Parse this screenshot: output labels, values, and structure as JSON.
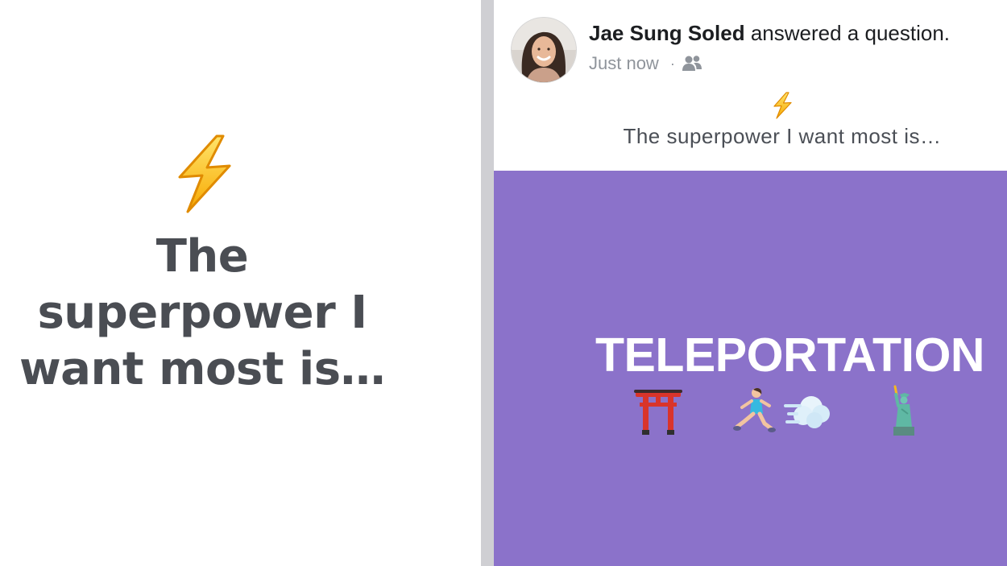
{
  "left_card": {
    "icon": "lightning-bolt-icon",
    "prompt_text": "The superpower I want most is…"
  },
  "post": {
    "author": {
      "name": "Jae Sung Soled",
      "avatar": "profile-photo"
    },
    "action_text": "answered a question.",
    "timestamp": "Just now",
    "separator": "·",
    "privacy_icon": "friends-icon",
    "question": {
      "icon": "lightning-bolt-icon",
      "text": "The superpower I want most is…"
    },
    "answer": {
      "text": "TELEPORTATION",
      "background_color": "#8b72ca",
      "emojis": [
        "torii-gate-icon",
        "running-woman-icon",
        "dash-cloud-icon",
        "statue-of-liberty-icon"
      ]
    }
  },
  "colors": {
    "prompt_text": "#4a4d53",
    "divider": "#cfcfd3",
    "answer_background": "#8b72ca",
    "meta_text": "#8f949b"
  }
}
